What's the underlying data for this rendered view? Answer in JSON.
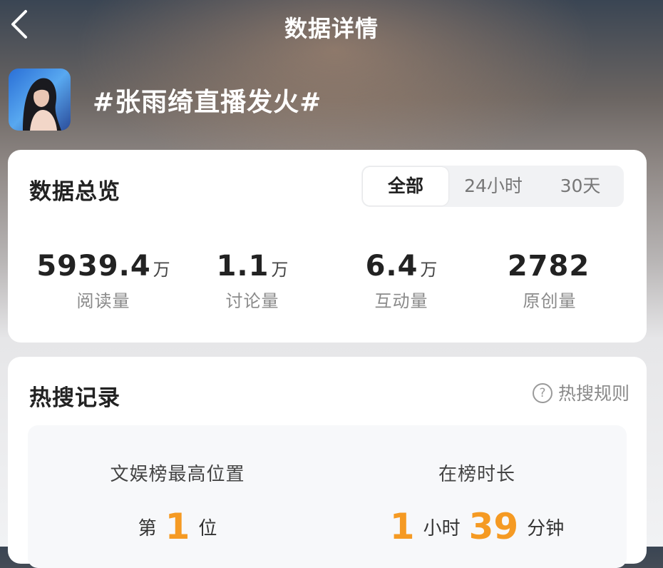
{
  "header": {
    "title": "数据详情",
    "back_icon": "chevron-left-icon"
  },
  "topic": {
    "title": "#张雨绮直播发火#",
    "avatar_icon": "avatar-image"
  },
  "overview": {
    "heading": "数据总览",
    "tabs": [
      {
        "label": "全部",
        "selected": true
      },
      {
        "label": "24小时",
        "selected": false
      },
      {
        "label": "30天",
        "selected": false
      }
    ],
    "stats": [
      {
        "value": "5939.4",
        "unit": "万",
        "label": "阅读量"
      },
      {
        "value": "1.1",
        "unit": "万",
        "label": "讨论量"
      },
      {
        "value": "6.4",
        "unit": "万",
        "label": "互动量"
      },
      {
        "value": "2782",
        "unit": "",
        "label": "原创量"
      }
    ]
  },
  "hot_search": {
    "heading": "热搜记录",
    "rules_label": "热搜规则",
    "rules_icon": "question-circle-icon",
    "peak": {
      "label": "文娱榜最高位置",
      "prefix": "第",
      "value": "1",
      "suffix": "位"
    },
    "duration": {
      "label": "在榜时长",
      "hours": "1",
      "hours_unit": "小时",
      "minutes": "39",
      "minutes_unit": "分钟"
    }
  },
  "colors": {
    "accent": "#f59a23",
    "card": "#ffffff",
    "muted_text": "#8a8a8a"
  }
}
